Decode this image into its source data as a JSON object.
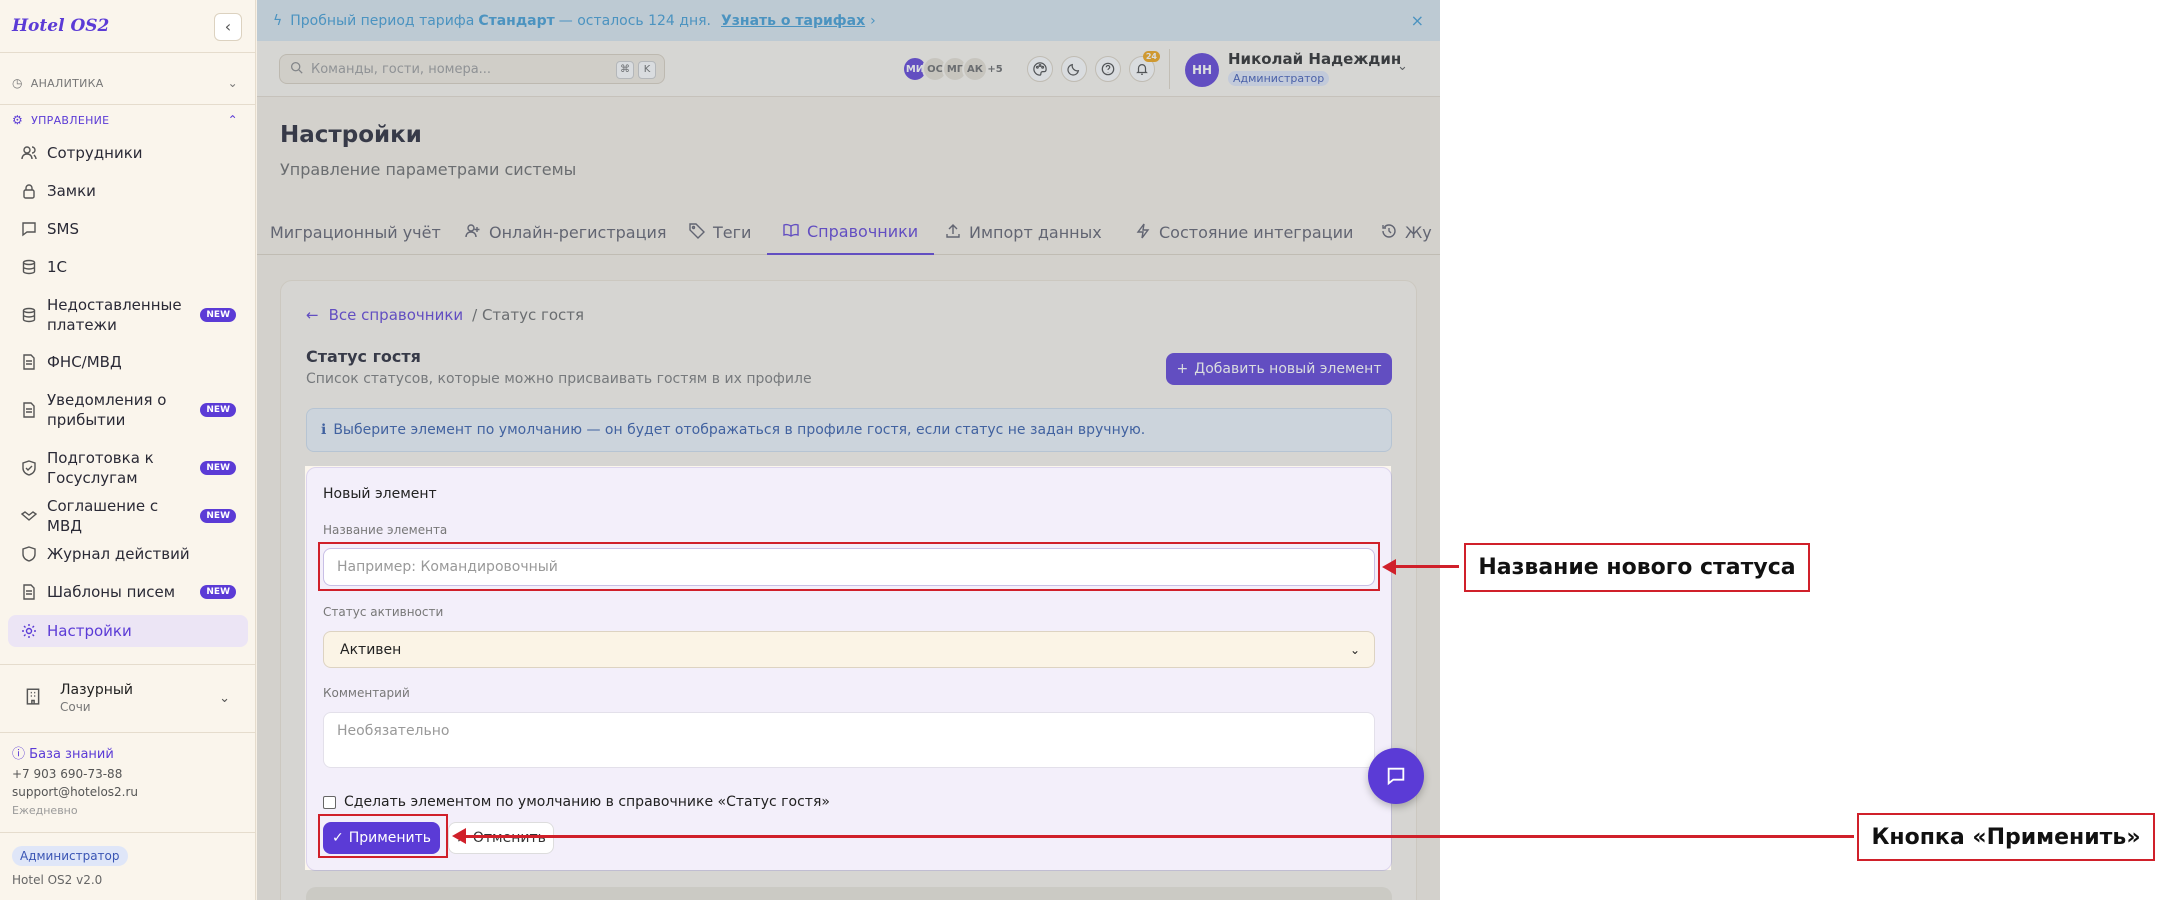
{
  "app": {
    "logo": "Hotel OS2"
  },
  "sidebar": {
    "sections": [
      {
        "label": "Аналитика",
        "expanded": false
      },
      {
        "label": "Управление",
        "expanded": true
      }
    ],
    "items": [
      {
        "label": "Сотрудники",
        "icon": "user-group-icon"
      },
      {
        "label": "Замки",
        "icon": "lock-icon"
      },
      {
        "label": "SMS",
        "icon": "message-icon"
      },
      {
        "label": "1С",
        "icon": "database-icon"
      },
      {
        "label": "Недоставленные платежи",
        "icon": "database-icon",
        "badge": "NEW"
      },
      {
        "label": "ФНС/МВД",
        "icon": "document-icon"
      },
      {
        "label": "Уведомления о прибытии",
        "icon": "document-icon",
        "badge": "NEW"
      },
      {
        "label": "Подготовка к Госуслугам",
        "icon": "shield-icon",
        "badge": "NEW"
      },
      {
        "label": "Соглашение с МВД",
        "icon": "handshake-icon",
        "badge": "NEW"
      },
      {
        "label": "Журнал действий",
        "icon": "shield-icon"
      },
      {
        "label": "Шаблоны писем",
        "icon": "document-icon",
        "badge": "NEW"
      },
      {
        "label": "Настройки",
        "icon": "gear-icon",
        "active": true
      }
    ],
    "hotel": {
      "name": "Лазурный",
      "city": "Сочи"
    },
    "kb_link": "База знаний",
    "phone": "+7 903 690-73-88",
    "email": "support@hotelos2.ru",
    "schedule": "Ежедневно",
    "role": "Администратор",
    "version": "Hotel OS2 v2.0"
  },
  "banner": {
    "prefix": "Пробный период тарифа",
    "plan": "Стандарт",
    "suffix": "— осталось 124 дня.",
    "link": "Узнать о тарифах",
    "link_arrow": "›"
  },
  "topbar": {
    "search_placeholder": "Команды, гости, номера...",
    "shortcut_1": "⌘",
    "shortcut_2": "K",
    "avatars": [
      {
        "initials": "МИ",
        "color": "#5b3bd6",
        "text_color": "#ffffff"
      },
      {
        "initials": "ОС",
        "color": "#e6dfd2",
        "text_color": "#666666"
      },
      {
        "initials": "МГ",
        "color": "#e6dfd2",
        "text_color": "#666666"
      },
      {
        "initials": "АК",
        "color": "#e6dfd2",
        "text_color": "#666666"
      }
    ],
    "avatars_more": "+5",
    "notif_count": "24",
    "user_initials": "НН",
    "user_name": "Николай Надеждин",
    "user_role": "Администратор"
  },
  "page": {
    "title": "Настройки",
    "subtitle": "Управление параметрами системы"
  },
  "tabs": [
    {
      "label": "Миграционный учёт",
      "icon": ""
    },
    {
      "label": "Онлайн-регистрация",
      "icon": "user-plus-icon"
    },
    {
      "label": "Теги",
      "icon": "tag-icon"
    },
    {
      "label": "Справочники",
      "icon": "book-icon",
      "active": true
    },
    {
      "label": "Импорт данных",
      "icon": "upload-icon"
    },
    {
      "label": "Состояние интеграции",
      "icon": "bolt-icon"
    },
    {
      "label": "Жу",
      "icon": "history-icon"
    }
  ],
  "directory": {
    "back_link": "Все справочники",
    "crumb_current": "/ Статус гостя",
    "title": "Статус гостя",
    "subtitle": "Список статусов, которые можно присваивать гостям в их профиле",
    "add_button": "Добавить новый элемент",
    "info_text": "Выберите элемент по умолчанию — он будет отображаться в профиле гостя, если статус не задан вручную."
  },
  "form": {
    "title": "Новый элемент",
    "name_label": "Название элемента",
    "name_placeholder": "Например: Командировочный",
    "status_label": "Статус активности",
    "status_value": "Активен",
    "comment_label": "Комментарий",
    "comment_placeholder": "Необязательно",
    "default_checkbox": "Сделать элементом по умолчанию в справочнике «Статус гостя»",
    "apply_button": "Применить",
    "cancel_button": "Отменить"
  },
  "annotations": {
    "name_callout": "Название нового статуса",
    "apply_callout": "Кнопка «Применить»",
    "color": "#d0202a"
  },
  "colors": {
    "accent": "#5b3bd6",
    "banner_text": "#3b9ad4"
  }
}
